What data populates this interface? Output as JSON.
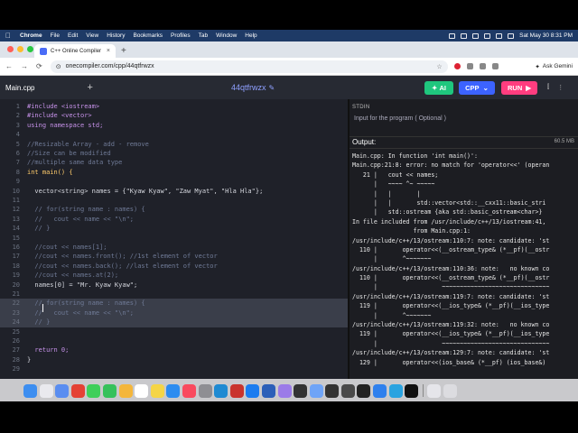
{
  "menubar": {
    "app": "Chrome",
    "items": [
      "File",
      "Edit",
      "View",
      "History",
      "Bookmarks",
      "Profiles",
      "Tab",
      "Window",
      "Help"
    ],
    "clock": "Sat May 30  8:31 PM"
  },
  "browser": {
    "tab_title": "C++ Online Compiler",
    "url": "onecompiler.com/cpp/44qtfrwzx",
    "gemini_label": "Ask Gemini"
  },
  "appbar": {
    "file_tab": "Main.cpp",
    "project_name": "44qtfrwzx",
    "ai_label": "AI",
    "language": "CPP",
    "run_label": "RUN",
    "colors": {
      "ai": "#1fc77e",
      "lang": "#3c63ff",
      "run": "#ff3d7f"
    }
  },
  "editor": {
    "lines": [
      {
        "n": "1",
        "t": "#include <iostream>",
        "c": "pp"
      },
      {
        "n": "2",
        "t": "#include <vector>",
        "c": "pp"
      },
      {
        "n": "3",
        "t": "using namespace std;",
        "c": "kw"
      },
      {
        "n": "4",
        "t": "",
        "c": ""
      },
      {
        "n": "5",
        "t": "//Resizable Array - add - remove",
        "c": "cm"
      },
      {
        "n": "6",
        "t": "//Size can be modified",
        "c": "cm"
      },
      {
        "n": "7",
        "t": "//multiple same data type",
        "c": "cm"
      },
      {
        "n": "8",
        "t": "int main() {",
        "c": "type"
      },
      {
        "n": "9",
        "t": "",
        "c": ""
      },
      {
        "n": "10",
        "t": "  vector<string> names = {\"Kyaw Kyaw\", \"Zaw Myat\", \"Hla Hla\"};",
        "c": ""
      },
      {
        "n": "11",
        "t": "",
        "c": ""
      },
      {
        "n": "12",
        "t": "  // for(string name : names) {",
        "c": "cm"
      },
      {
        "n": "13",
        "t": "  //   cout << name << \"\\n\";",
        "c": "cm"
      },
      {
        "n": "14",
        "t": "  // }",
        "c": "cm"
      },
      {
        "n": "15",
        "t": "",
        "c": ""
      },
      {
        "n": "16",
        "t": "  //cout << names[1];",
        "c": "cm"
      },
      {
        "n": "17",
        "t": "  //cout << names.front(); //1st element of vector",
        "c": "cm"
      },
      {
        "n": "18",
        "t": "  //cout << names.back(); //last element of vector",
        "c": "cm"
      },
      {
        "n": "19",
        "t": "  //cout << names.at(2);",
        "c": "cm"
      },
      {
        "n": "20",
        "t": "  names[0] = \"Mr. Kyaw Kyaw\";",
        "c": ""
      },
      {
        "n": "21",
        "t": "",
        "c": ""
      },
      {
        "n": "22",
        "t": "  // for(string name : names) {",
        "c": "cm"
      },
      {
        "n": "23",
        "t": "  //   cout << name << \"\\n\";",
        "c": "cm"
      },
      {
        "n": "24",
        "t": "  // }",
        "c": "cm"
      },
      {
        "n": "25",
        "t": "",
        "c": ""
      },
      {
        "n": "26",
        "t": "",
        "c": ""
      },
      {
        "n": "27",
        "t": "  return 0;",
        "c": "kw"
      },
      {
        "n": "28",
        "t": "}",
        "c": ""
      },
      {
        "n": "29",
        "t": "",
        "c": ""
      }
    ],
    "selected_lines": [
      "22",
      "23",
      "24"
    ]
  },
  "right_panel": {
    "stdin_label": "STDIN",
    "stdin_placeholder": "Input for the program ( Optional )",
    "output_label": "Output:",
    "memory": "60.5 MB",
    "output_lines": [
      "Main.cpp: In function 'int main()':",
      "Main.cpp:21:8: error: no match for 'operator<<' (operan",
      "   21 |   cout << names;",
      "      |   ~~~~ ^~ ~~~~~",
      "      |   |       |",
      "      |   |       std::vector<std::__cxx11::basic_stri",
      "      |   std::ostream {aka std::basic_ostream<char>}",
      "In file included from /usr/include/c++/13/iostream:41,",
      "                 from Main.cpp:1:",
      "/usr/include/c++/13/ostream:110:7: note: candidate: 'st",
      "  110 |       operator<<(__ostream_type& (*__pf)(__ostr",
      "      |       ^~~~~~~~",
      "/usr/include/c++/13/ostream:110:36: note:   no known co",
      "  110 |       operator<<(__ostream_type& (*__pf)(__ostr",
      "      |                  ~~~~~~~~~~~~~~~~~~~~~~~~~~~~~~",
      "/usr/include/c++/13/ostream:119:7: note: candidate: 'st",
      "  119 |       operator<<(__ios_type& (*__pf)(__ios_type",
      "      |       ^~~~~~~~",
      "/usr/include/c++/13/ostream:119:32: note:   no known co",
      "  119 |       operator<<(__ios_type& (*__pf)(__ios_type",
      "      |                  ~~~~~~~~~~~~~~~~~~~~~~~~~~~~~~",
      "/usr/include/c++/13/ostream:129:7: note: candidate: 'st",
      "  129 |       operator<<(ios_base& (*__pf) (ios_base&)"
    ]
  },
  "dock": {
    "icons": [
      {
        "name": "finder-icon",
        "color": "#3d8ef0"
      },
      {
        "name": "launchpad-icon",
        "color": "#e9e9ee"
      },
      {
        "name": "calendar-grid-icon",
        "color": "#5a8df0"
      },
      {
        "name": "chrome-icon",
        "color": "#e44134"
      },
      {
        "name": "messages-icon",
        "color": "#3fcf5a"
      },
      {
        "name": "facetime-icon",
        "color": "#36c15b"
      },
      {
        "name": "photos-icon",
        "color": "#f4b63c"
      },
      {
        "name": "calendar-icon",
        "color": "#ffffff"
      },
      {
        "name": "notes-icon",
        "color": "#f5d547"
      },
      {
        "name": "app-store-icon",
        "color": "#2d8cf0"
      },
      {
        "name": "music-icon",
        "color": "#f94a5e"
      },
      {
        "name": "settings-icon",
        "color": "#8e8e93"
      },
      {
        "name": "vscode-icon",
        "color": "#1f8ad2"
      },
      {
        "name": "terminal-red-icon",
        "color": "#c9342d"
      },
      {
        "name": "xcode-icon",
        "color": "#1b7cf0"
      },
      {
        "name": "word-icon",
        "color": "#2b5fb8"
      },
      {
        "name": "zoom-icon",
        "color": "#9b7be8"
      },
      {
        "name": "dark-app-icon",
        "color": "#333333"
      },
      {
        "name": "preview-icon",
        "color": "#6fa4f7"
      },
      {
        "name": "camera-icon",
        "color": "#333333"
      },
      {
        "name": "screen-icon",
        "color": "#4a4a4a"
      },
      {
        "name": "terminal-icon",
        "color": "#222222"
      },
      {
        "name": "safari-icon",
        "color": "#2f80ed"
      },
      {
        "name": "telegram-icon",
        "color": "#2aa3e0"
      },
      {
        "name": "chatgpt-icon",
        "color": "#111111"
      },
      {
        "name": "folder-icon",
        "color": "#e5e5ea"
      },
      {
        "name": "trash-icon",
        "color": "#dcdce0"
      }
    ]
  }
}
